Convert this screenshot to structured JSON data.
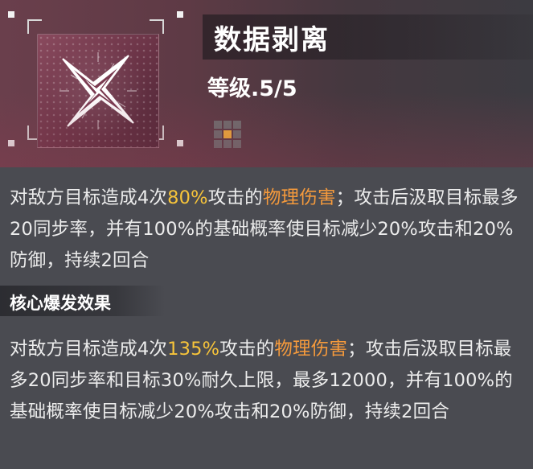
{
  "skill": {
    "name": "数据剥离",
    "level_label": "等级.5/5",
    "level_current": 5,
    "level_max": 5,
    "icon": "shuriken-star-icon"
  },
  "description": {
    "p1": "对敌方目标造成4次",
    "pct": "80%",
    "p2": "攻击的",
    "dmg_type": "物理伤害",
    "p3": "；攻击后汲取目标最多20同步率，并有100%的",
    "base_chance": "基础概率",
    "p4": "使目标减少20%攻击和20%防御，持续2回合"
  },
  "core_burst": {
    "title": "核心爆发效果",
    "p1": "对敌方目标造成4次",
    "pct": "135%",
    "p2": "攻击的",
    "dmg_type": "物理伤害",
    "p3": "；攻击后汲取目标最多20同步率和目标30%耐久上限，最多12000，并有100%的",
    "base_chance": "基础概率",
    "p4": "使目标减少20%攻击和20%防御，持续2回合"
  },
  "colors": {
    "highlight_orange": "#f59a3c",
    "highlight_gold": "#f7c43a",
    "level_active": "#f4b03a",
    "background": "#4a4b51"
  }
}
